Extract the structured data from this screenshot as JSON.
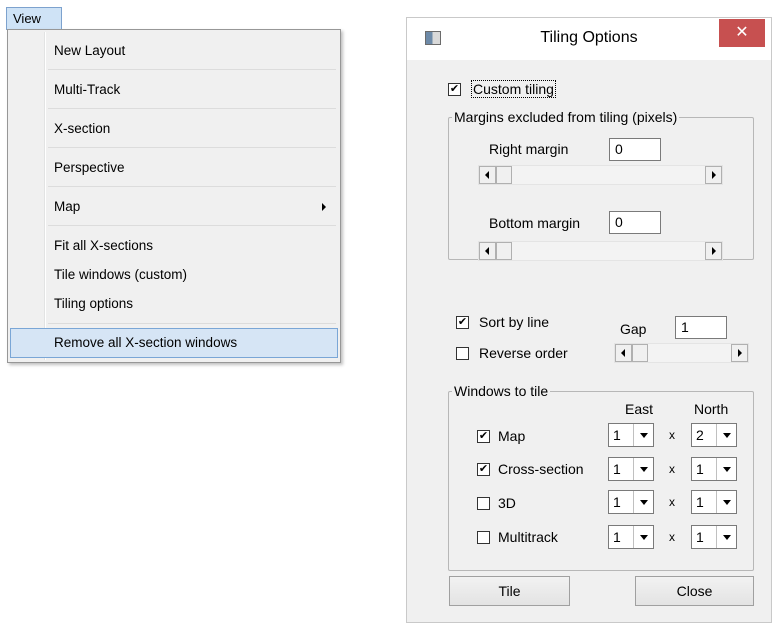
{
  "menu": {
    "title": "View",
    "items": [
      {
        "label": "New Layout"
      },
      {
        "label": "Multi-Track"
      },
      {
        "label": "X-section"
      },
      {
        "label": "Perspective"
      },
      {
        "label": "Map"
      },
      {
        "label": "Fit all X-sections"
      },
      {
        "label": "Tile windows (custom)"
      },
      {
        "label": "Tiling options"
      },
      {
        "label": "Remove all X-section windows"
      }
    ]
  },
  "dialog": {
    "title": "Tiling Options",
    "close_symbol": "✕",
    "custom_tiling": {
      "label": "Custom tiling",
      "checked": true
    },
    "margins": {
      "legend": "Margins excluded from tiling (pixels)",
      "right_label": "Right margin",
      "right_value": "0",
      "bottom_label": "Bottom margin",
      "bottom_value": "0"
    },
    "sort_by_line": {
      "label": "Sort by line",
      "checked": true
    },
    "reverse_order": {
      "label": "Reverse order",
      "checked": false
    },
    "gap": {
      "label": "Gap",
      "value": "1"
    },
    "windows": {
      "legend": "Windows to tile",
      "east_header": "East",
      "north_header": "North",
      "x_symbol": "x",
      "rows": [
        {
          "label": "Map",
          "checked": true,
          "east": "1",
          "north": "2"
        },
        {
          "label": "Cross-section",
          "checked": true,
          "east": "1",
          "north": "1"
        },
        {
          "label": "3D",
          "checked": false,
          "east": "1",
          "north": "1"
        },
        {
          "label": "Multitrack",
          "checked": false,
          "east": "1",
          "north": "1"
        }
      ]
    },
    "tile_button": "Tile",
    "close_button": "Close",
    "check_mark": "✔"
  }
}
